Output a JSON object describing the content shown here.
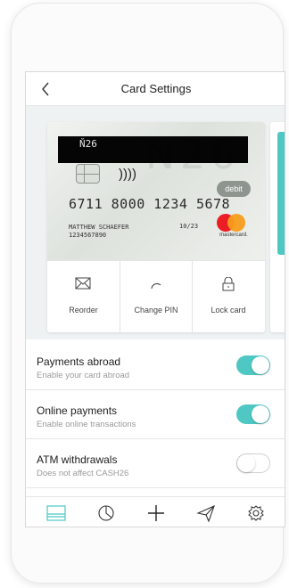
{
  "header": {
    "title": "Card Settings"
  },
  "card": {
    "brand": "Ň26",
    "watermark": "N26",
    "contactless": "))))",
    "type_badge": "debit",
    "number": "6711 8000 1234 5678",
    "expiry": "10/23",
    "holder_name": "MATTHEW SCHAEFER",
    "holder_id": "1234567890",
    "network": "mastercard."
  },
  "actions": [
    {
      "label": "Reorder",
      "icon": "envelope-icon"
    },
    {
      "label": "Change PIN",
      "icon": "pin-arc-icon"
    },
    {
      "label": "Lock card",
      "icon": "lock-icon"
    }
  ],
  "settings": [
    {
      "title": "Payments abroad",
      "subtitle": "Enable your card abroad",
      "enabled": true
    },
    {
      "title": "Online payments",
      "subtitle": "Enable online transactions",
      "enabled": true
    },
    {
      "title": "ATM withdrawals",
      "subtitle": "Does not affect CASH26",
      "enabled": false
    }
  ],
  "tabbar": [
    {
      "icon": "cards-icon",
      "active": true
    },
    {
      "icon": "stats-icon",
      "active": false
    },
    {
      "icon": "plus-icon",
      "active": false
    },
    {
      "icon": "send-icon",
      "active": false
    },
    {
      "icon": "gear-icon",
      "active": false
    }
  ],
  "colors": {
    "accent": "#4fc8c3",
    "text": "#1d1d1d",
    "muted": "#9a9a9a"
  }
}
